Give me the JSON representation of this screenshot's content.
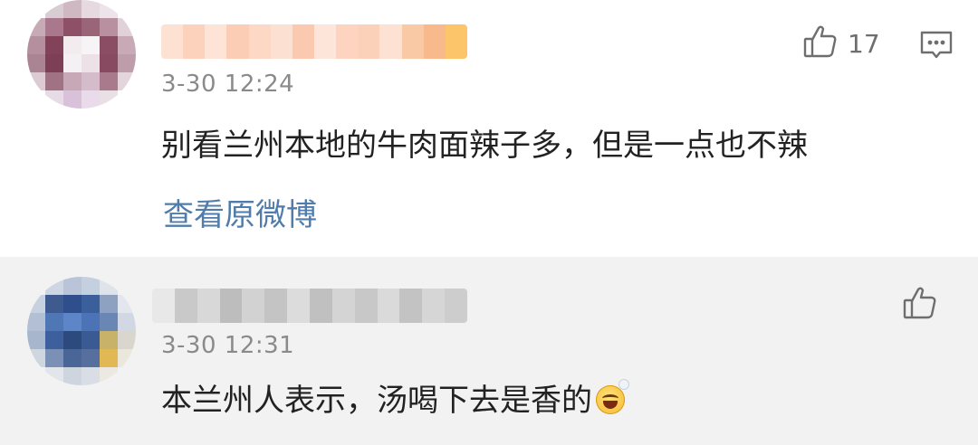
{
  "comments": [
    {
      "time": "3-30 12:24",
      "content": "别看兰州本地的牛肉面辣子多，但是一点也不辣",
      "like_count": "17",
      "link_label": "查看原微博",
      "icons": {
        "like": "thumb-up-icon",
        "reply": "comment-bubble-icon"
      }
    },
    {
      "time": "3-30 12:31",
      "content": "本兰州人表示，汤喝下去是香的",
      "emoji": "hot-steaming-face-emoji",
      "icons": {
        "like": "thumb-up-icon"
      }
    }
  ]
}
